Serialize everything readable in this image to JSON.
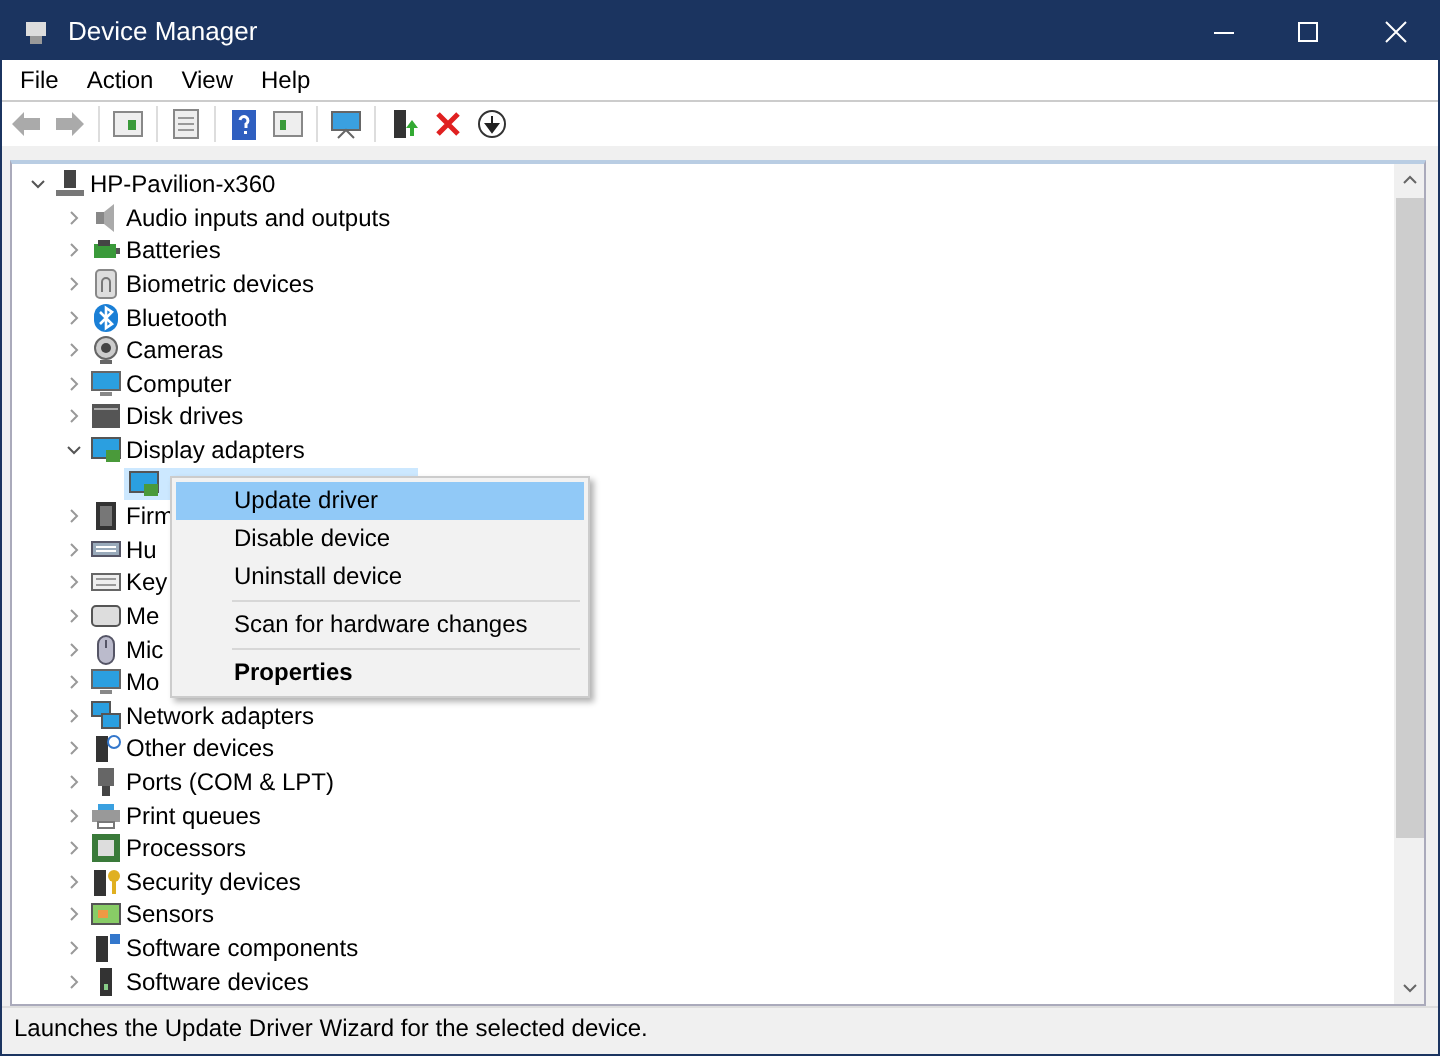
{
  "window": {
    "title": "Device Manager"
  },
  "menu": [
    "File",
    "Action",
    "View",
    "Help"
  ],
  "tree": {
    "label": "HP-Pavilion-x360",
    "expanded": true,
    "children": [
      {
        "label": "Audio inputs and outputs",
        "expanded": false
      },
      {
        "label": "Batteries",
        "expanded": false
      },
      {
        "label": "Biometric devices",
        "expanded": false
      },
      {
        "label": "Bluetooth",
        "expanded": false
      },
      {
        "label": "Cameras",
        "expanded": false
      },
      {
        "label": "Computer",
        "expanded": false
      },
      {
        "label": "Disk drives",
        "expanded": false
      },
      {
        "label": "Display adapters",
        "expanded": true,
        "children": [
          {
            "selected": true
          }
        ]
      },
      {
        "label": "Firm",
        "expanded": false
      },
      {
        "label": "Hu",
        "expanded": false
      },
      {
        "label": "Key",
        "expanded": false
      },
      {
        "label": "Me",
        "expanded": false
      },
      {
        "label": "Mic",
        "expanded": false
      },
      {
        "label": "Mo",
        "expanded": false
      },
      {
        "label": "Network adapters",
        "expanded": false
      },
      {
        "label": "Other devices",
        "expanded": false
      },
      {
        "label": "Ports (COM & LPT)",
        "expanded": false
      },
      {
        "label": "Print queues",
        "expanded": false
      },
      {
        "label": "Processors",
        "expanded": false
      },
      {
        "label": "Security devices",
        "expanded": false
      },
      {
        "label": "Sensors",
        "expanded": false
      },
      {
        "label": "Software components",
        "expanded": false
      },
      {
        "label": "Software devices",
        "expanded": false
      }
    ]
  },
  "context_menu": {
    "items": [
      {
        "kind": "item",
        "label": "Update driver",
        "selected": true,
        "default": false
      },
      {
        "kind": "item",
        "label": "Disable device",
        "selected": false,
        "default": false
      },
      {
        "kind": "item",
        "label": "Uninstall device",
        "selected": false,
        "default": false
      },
      {
        "kind": "separator"
      },
      {
        "kind": "item",
        "label": "Scan for hardware changes",
        "selected": false,
        "default": false
      },
      {
        "kind": "separator"
      },
      {
        "kind": "item",
        "label": "Properties",
        "selected": false,
        "default": true
      }
    ]
  },
  "status_bar": "Launches the Update Driver Wizard for the selected device."
}
